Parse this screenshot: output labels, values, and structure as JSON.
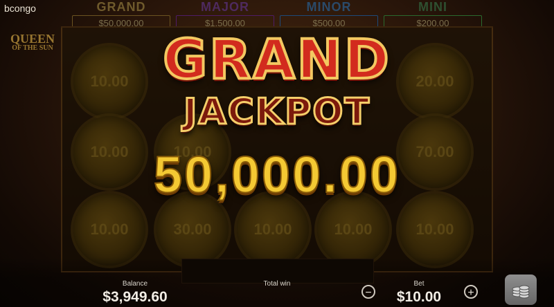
{
  "brand": "bcongo",
  "game_title": {
    "line1": "QUEEN",
    "line2": "OF THE SUN"
  },
  "jackpots": [
    {
      "name": "GRAND",
      "amount": "$50,000.00",
      "color": "#d4a23a"
    },
    {
      "name": "MAJOR",
      "amount": "$1,500.00",
      "color": "#9b2bd0"
    },
    {
      "name": "MINOR",
      "amount": "$500.00",
      "color": "#2b7fd8"
    },
    {
      "name": "MINI",
      "amount": "$200.00",
      "color": "#3aa84a"
    }
  ],
  "reel_values": [
    [
      "10.00",
      "",
      "",
      "",
      "20.00"
    ],
    [
      "10.00",
      "10.00",
      "",
      "",
      "70.00"
    ],
    [
      "10.00",
      "30.00",
      "10.00",
      "10.00",
      "10.00"
    ]
  ],
  "win_banner": {
    "line1": "GRAND",
    "line2": "JACKPOT",
    "amount": "50,000.00"
  },
  "bottom": {
    "balance_label": "Balance",
    "balance_value": "$3,949.60",
    "total_win_label": "Total win",
    "total_win_value": "",
    "bet_label": "Bet",
    "bet_value": "$10.00",
    "minus": "−",
    "plus": "+"
  },
  "icons": {
    "coins": "coin-stack-icon"
  }
}
